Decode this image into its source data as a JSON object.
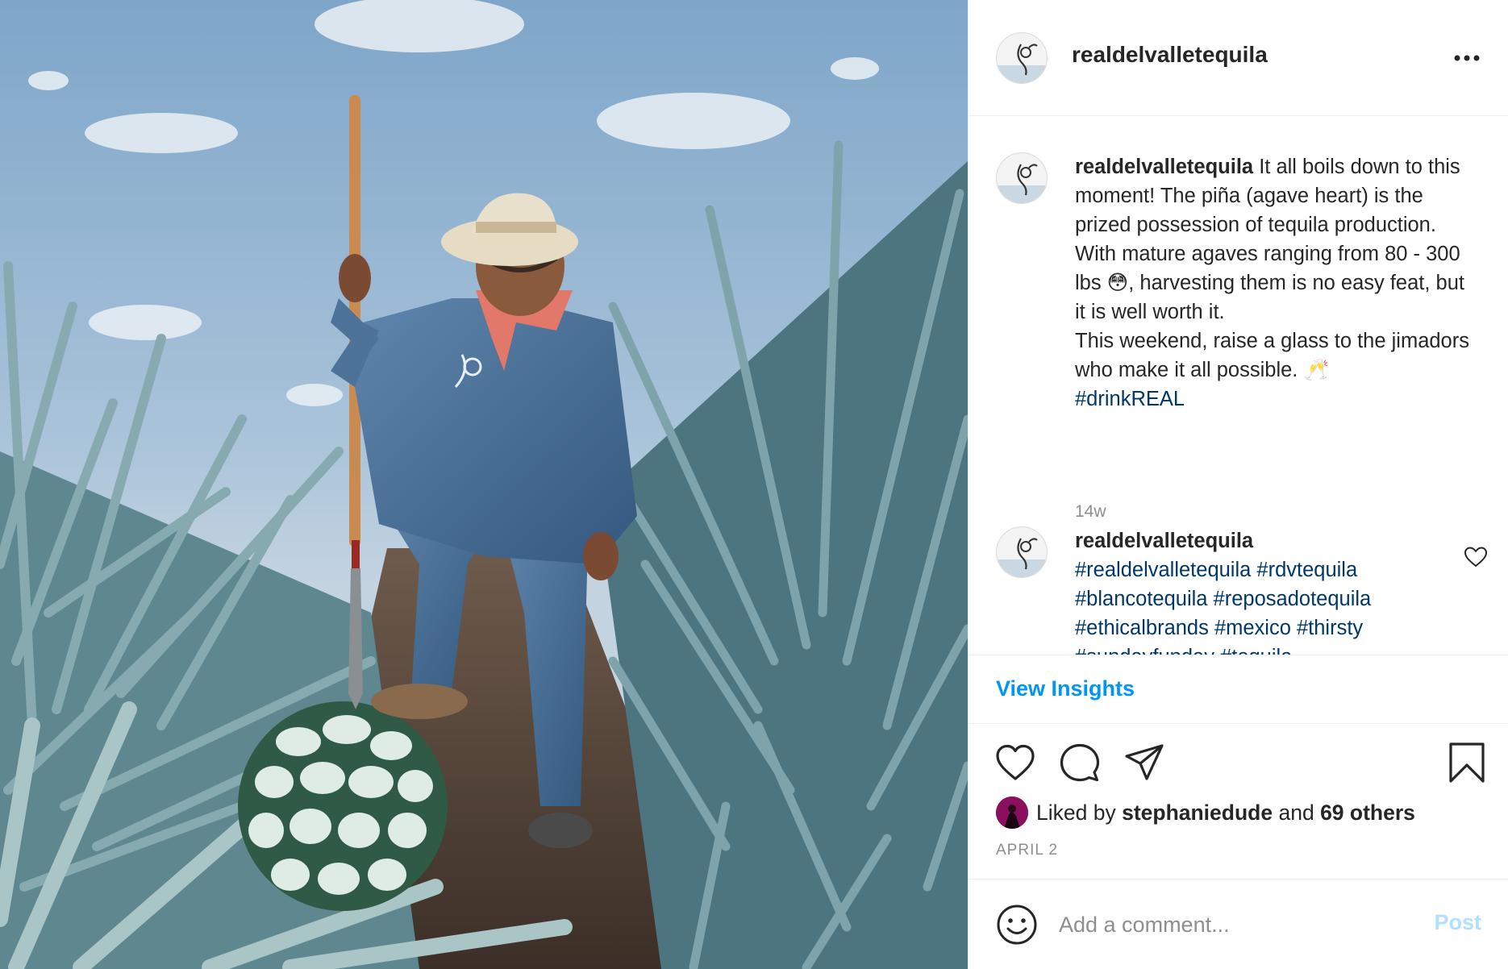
{
  "post": {
    "username": "realdelvalletequila",
    "timestamp_relative": "14w",
    "date": "APRIL 2"
  },
  "caption": {
    "username": "realdelvalletequila",
    "lines": [
      "It all boils down to this moment! The piña (agave heart) is the prized possession of tequila production. With mature agaves ranging from 80 - 300 lbs 😳, harvesting them is no easy feat, but it is well worth it.",
      "This weekend, raise a glass to the jimadors who make it all possible. 🥂"
    ],
    "hashtag": "#drinkREAL"
  },
  "second_comment": {
    "username": "realdelvalletequila",
    "hashtags": "#realdelvalletequila #rdvtequila #blancotequila #reposadotequila #ethicalbrands #mexico #thirsty #sundayfunday #tequila"
  },
  "insights": {
    "label": "View Insights"
  },
  "likes": {
    "prefix": "Liked by",
    "user": "stephaniedude",
    "conjunction": "and",
    "others": "69 others"
  },
  "add_comment": {
    "placeholder": "Add a comment...",
    "post_label": "Post"
  },
  "icons": {
    "more": "more-horizontal-icon",
    "like": "heart-icon",
    "comment": "comment-bubble-icon",
    "share": "paper-plane-icon",
    "save": "bookmark-icon",
    "emoji": "smiley-icon"
  },
  "colors": {
    "link": "#0095f6",
    "hashtag": "#00376b",
    "post_disabled": "#b2dffc",
    "muted": "#8e8e8e"
  }
}
